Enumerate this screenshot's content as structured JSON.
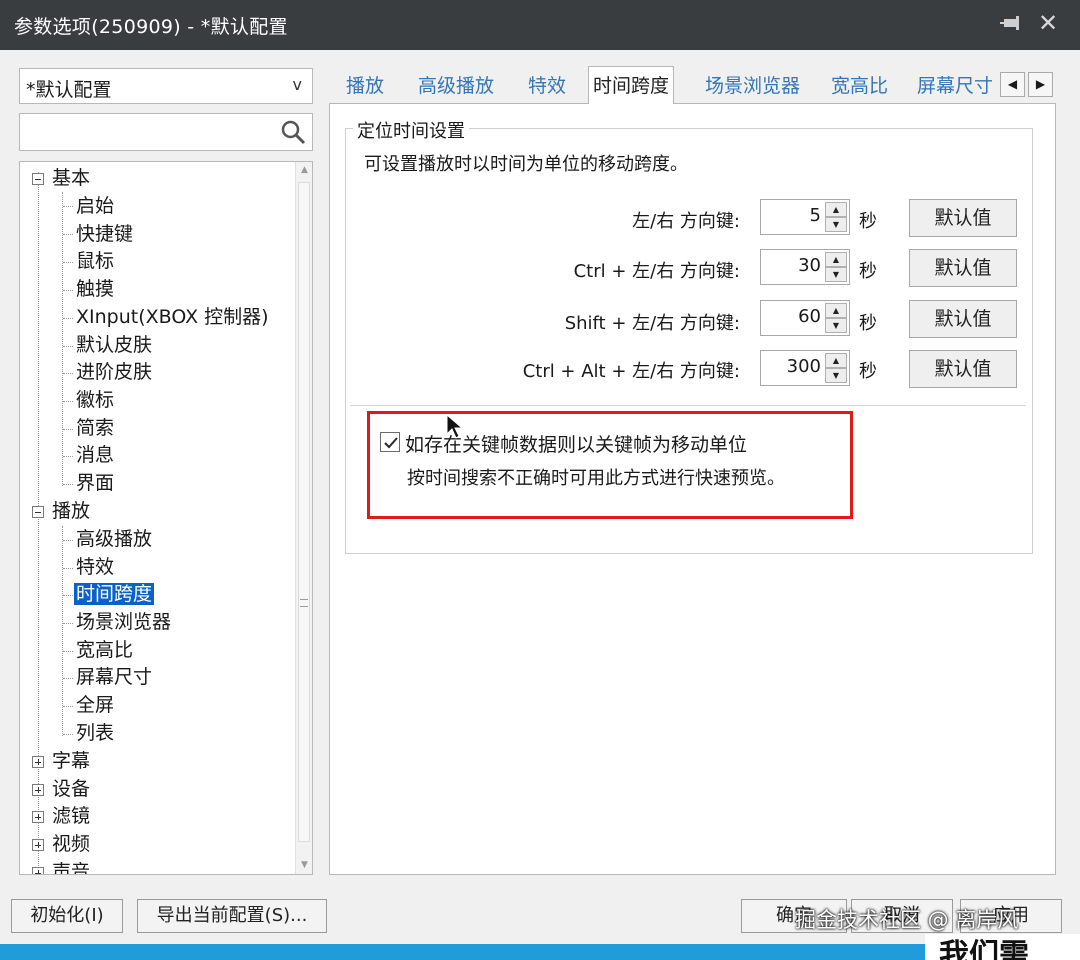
{
  "window": {
    "title": "参数选项(250909) - *默认配置"
  },
  "profile": {
    "value": "*默认配置"
  },
  "search": {
    "value": "",
    "placeholder": ""
  },
  "tree": {
    "groups": [
      {
        "label": "基本",
        "expanded": true,
        "children": [
          "启始",
          "快捷键",
          "鼠标",
          "触摸",
          "XInput(XBOX 控制器)",
          "默认皮肤",
          "进阶皮肤",
          "徽标",
          "简索",
          "消息",
          "界面"
        ]
      },
      {
        "label": "播放",
        "expanded": true,
        "children": [
          "高级播放",
          "特效",
          "时间跨度",
          "场景浏览器",
          "宽高比",
          "屏幕尺寸",
          "全屏",
          "列表"
        ]
      },
      {
        "label": "字幕",
        "expanded": false
      },
      {
        "label": "设备",
        "expanded": false
      },
      {
        "label": "滤镜",
        "expanded": false
      },
      {
        "label": "视频",
        "expanded": false
      },
      {
        "label": "声音",
        "expanded": false
      }
    ],
    "selected": "时间跨度"
  },
  "tabs": [
    "播放",
    "高级播放",
    "特效",
    "时间跨度",
    "场景浏览器",
    "宽高比",
    "屏幕尺寸"
  ],
  "active_tab": "时间跨度",
  "group": {
    "title": "定位时间设置",
    "description": "可设置播放时以时间为单位的移动跨度。",
    "rows": [
      {
        "label": "左/右 方向键:",
        "value": "5",
        "unit": "秒",
        "button": "默认值"
      },
      {
        "label": "Ctrl + 左/右 方向键:",
        "value": "30",
        "unit": "秒",
        "button": "默认值"
      },
      {
        "label": "Shift + 左/右 方向键:",
        "value": "60",
        "unit": "秒",
        "button": "默认值"
      },
      {
        "label": "Ctrl + Alt + 左/右 方向键:",
        "value": "300",
        "unit": "秒",
        "button": "默认值"
      }
    ]
  },
  "keyframe": {
    "checked": true,
    "label": "如存在关键帧数据则以关键帧为移动单位",
    "note": "按时间搜索不正确时可用此方式进行快速预览。"
  },
  "bottom": {
    "reset_label": "初始化(I)",
    "export_label": "导出当前配置(S)...",
    "ok_label": "确定",
    "cancel_label": "取消",
    "apply_label": "应用"
  },
  "overlay": {
    "watermark": "掘金技术社区 @ 离岸风",
    "caption": "我们需"
  },
  "colors": {
    "highlight": "#e0191c",
    "selection": "#0a62c8",
    "titlebar": "#3a3d40",
    "tab_text": "#3575b5"
  }
}
